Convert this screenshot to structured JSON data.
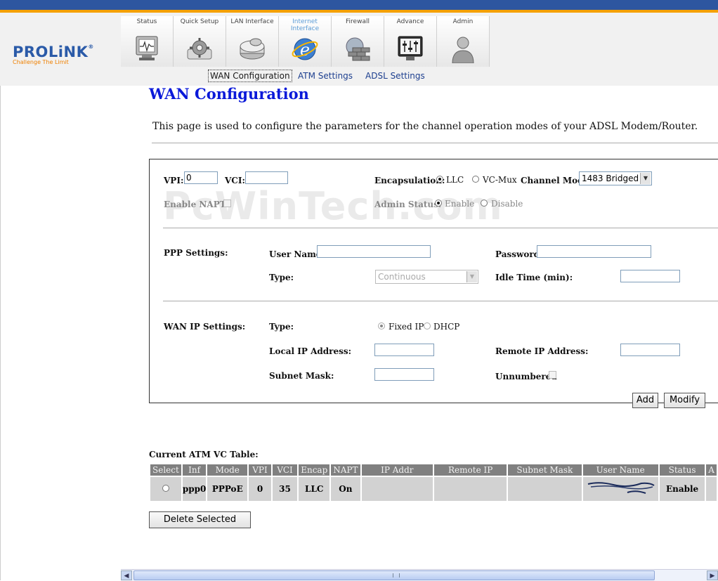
{
  "brand": {
    "name": "PROLiNK",
    "registered": "®",
    "tagline": "Challenge The Limit"
  },
  "nav": {
    "tabs": [
      {
        "label": "Status",
        "icon": "monitor-icon"
      },
      {
        "label": "Quick Setup",
        "icon": "gear-icon"
      },
      {
        "label": "LAN Interface",
        "icon": "network-drive-icon"
      },
      {
        "label": "Internet Interface",
        "icon": "internet-explorer-icon"
      },
      {
        "label": "Firewall",
        "icon": "firewall-icon"
      },
      {
        "label": "Advance",
        "icon": "advanced-settings-icon"
      },
      {
        "label": "Admin",
        "icon": "admin-user-icon"
      }
    ],
    "active_tab": "Internet Interface"
  },
  "subnav": {
    "items": [
      "WAN Configuration",
      "ATM Settings",
      "ADSL Settings"
    ],
    "selected": "WAN Configuration"
  },
  "page": {
    "title": "WAN Configuration",
    "description": "This page is used to configure the parameters for the channel operation modes of your ADSL Modem/Router."
  },
  "watermark": "PcWinTech.com",
  "form": {
    "vpi": {
      "label": "VPI:",
      "value": "0"
    },
    "vci": {
      "label": "VCI:",
      "value": ""
    },
    "encapsulation": {
      "label": "Encapsulation:",
      "options": [
        "LLC",
        "VC-Mux"
      ],
      "selected": "LLC"
    },
    "channel_mode": {
      "label": "Channel Mode:",
      "value": "1483 Bridged"
    },
    "enable_napt": {
      "label": "Enable NAPT:",
      "checked": false
    },
    "admin_status": {
      "label": "Admin Status:",
      "options": [
        "Enable",
        "Disable"
      ],
      "selected": "Enable"
    },
    "ppp": {
      "section_label": "PPP Settings:",
      "user_name_label": "User Name:",
      "user_name": "",
      "password_label": "Password:",
      "password": "",
      "type_label": "Type:",
      "type_value": "Continuous",
      "idle_time_label": "Idle Time (min):",
      "idle_time": ""
    },
    "wan_ip": {
      "section_label": "WAN IP Settings:",
      "type_label": "Type:",
      "type_options": [
        "Fixed IP",
        "DHCP"
      ],
      "type_selected": "Fixed IP",
      "local_ip_label": "Local IP Address:",
      "local_ip": "",
      "remote_ip_label": "Remote IP Address:",
      "remote_ip": "",
      "subnet_mask_label": "Subnet Mask:",
      "subnet_mask": "",
      "unnumbered_label": "Unnumbered",
      "unnumbered_checked": false
    },
    "buttons": {
      "add": "Add",
      "modify": "Modify"
    }
  },
  "vc_table": {
    "title": "Current ATM VC Table:",
    "columns": [
      "Select",
      "Inf",
      "Mode",
      "VPI",
      "VCI",
      "Encap",
      "NAPT",
      "IP Addr",
      "Remote IP",
      "Subnet Mask",
      "User Name",
      "Status",
      "A"
    ],
    "rows": [
      {
        "select": false,
        "inf": "ppp0",
        "mode": "PPPoE",
        "vpi": "0",
        "vci": "35",
        "encap": "LLC",
        "napt": "On",
        "ip_addr": "",
        "remote_ip": "",
        "subnet_mask": "",
        "user_name": "",
        "status": "Enable"
      }
    ],
    "delete_button": "Delete Selected"
  },
  "colors": {
    "header_blue": "#2d56a0",
    "header_orange": "#f5a100",
    "title_blue": "#0a19d9",
    "table_header": "#808080",
    "table_cell": "#d2d2d2"
  }
}
